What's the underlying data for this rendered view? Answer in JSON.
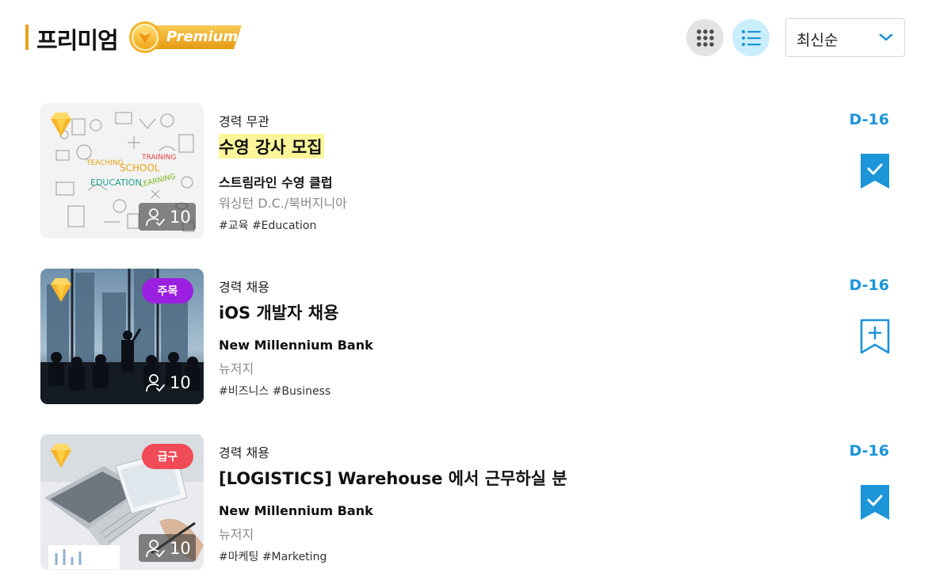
{
  "header": {
    "title": "프리미엄",
    "premium_badge": "Premium",
    "sort": {
      "selected": "최신순"
    }
  },
  "colors": {
    "accent_blue": "#1c95d9",
    "highlight_yellow": "#fbf69a",
    "tag_featured": "#9b1fe0",
    "tag_urgent": "#f14b57",
    "premium_gold": "#f0b432"
  },
  "jobs": [
    {
      "career": "경력 무관",
      "title": "수영 강사 모집",
      "title_highlighted": true,
      "company": "스트림라인 수영 클럽",
      "location": "워싱턴 D.C./북버지니아",
      "hashtags": "#교육 #Education",
      "dday": "D-16",
      "applicants": "10",
      "tag": "",
      "bookmarked": true,
      "image": "education-doodle",
      "image_words": [
        "TEACHING",
        "SCHOOL",
        "TRAINING",
        "EDUCATION",
        "LEARNING"
      ]
    },
    {
      "career": "경력 채용",
      "title": "iOS 개발자 채용",
      "title_highlighted": false,
      "company": "New Millennium Bank",
      "location": "뉴저지",
      "hashtags": "#비즈니스 #Business",
      "dday": "D-16",
      "applicants": "10",
      "tag": "주목",
      "bookmarked": false,
      "image": "business-meeting"
    },
    {
      "career": "경력 채용",
      "title": "[LOGISTICS] Warehouse 에서 근무하실 분",
      "title_highlighted": false,
      "company": "New Millennium Bank",
      "location": "뉴저지",
      "hashtags": "#마케팅 #Marketing",
      "dday": "D-16",
      "applicants": "10",
      "tag": "급구",
      "bookmarked": true,
      "image": "laptop-desk"
    }
  ]
}
